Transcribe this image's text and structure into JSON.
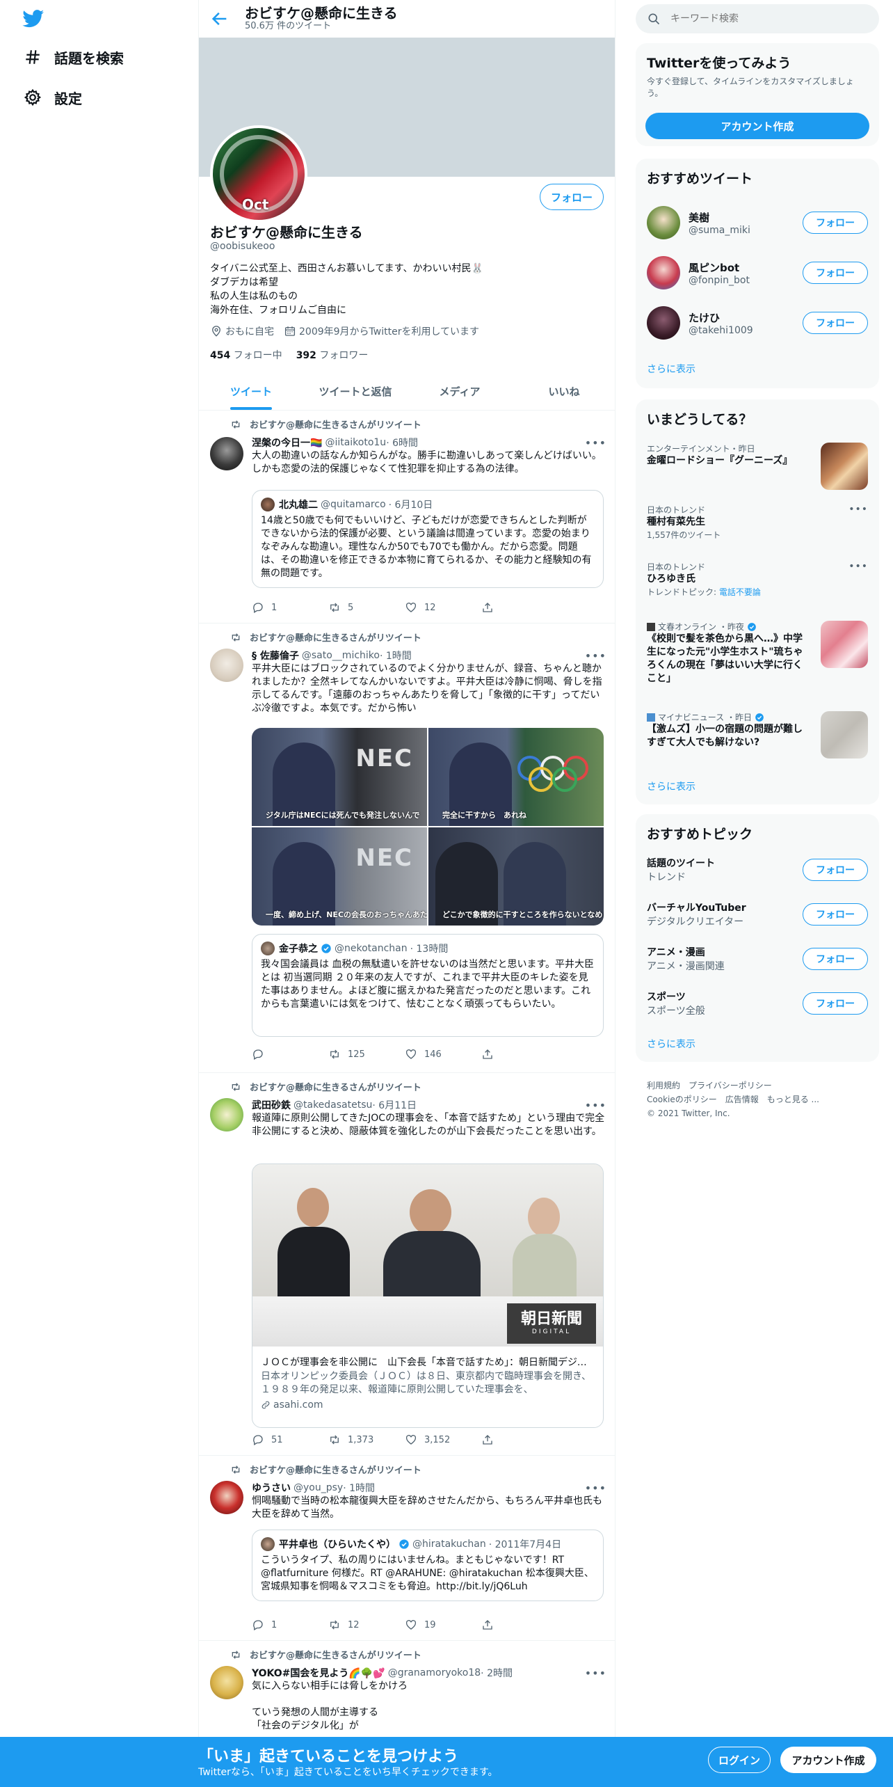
{
  "nav": {
    "explore": "話題を検索",
    "settings": "設定"
  },
  "header": {
    "title": "おビすケ@懸命に生きる",
    "tweet_count": "50.6万 件のツイート"
  },
  "profile": {
    "name": "おビすケ@懸命に生きる",
    "handle": "@oobisukeoo",
    "avatar_text": "Oct",
    "bio": [
      "タイバニ公式至上、西田さんお慕いしてます、かわいい村民🐰",
      "ダブデカは希望",
      "私の人生は私のもの",
      "海外在住、フォロリムご自由に"
    ],
    "location": "おもに自宅",
    "joined": "2009年9月からTwitterを利用しています",
    "following_count": "454",
    "following_label": "フォロー中",
    "followers_count": "392",
    "followers_label": "フォロワー",
    "follow_button": "フォロー"
  },
  "tabs": [
    "ツイート",
    "ツイートと返信",
    "メディア",
    "いいね"
  ],
  "tweets": [
    {
      "retweet_label": "おビすケ@懸命に生きるさんがリツイート",
      "name": "涅槃の今日一🏳️‍🌈",
      "handle": "@iitaikoto1u",
      "time": "· 6時間",
      "text": "大人の勘違いの話なんか知らんがな。勝手に勘違いしあって楽しんどけばいい。しかも恋愛の法的保護じゃなくて性犯罪を抑止する為の法律。",
      "quote": {
        "name": "北丸雄二",
        "handle": "@quitamarco",
        "time": "· 6月10日",
        "text": "14歳と50歳でも何でもいいけど、子どもだけが恋愛できちんとした判断ができないから法的保護が必要、という議論は間違っています。恋愛の始まりなぞみんな勘違い。理性なんか50でも70でも働かん。だから恋愛。問題は、その勘違いを修正できるか本物に育てられるか、その能力と経験知の有無の問題です。"
      },
      "replies": "1",
      "retweets": "5",
      "likes": "12"
    },
    {
      "retweet_label": "おビすケ@懸命に生きるさんがリツイート",
      "name": "§ 佐藤倫子",
      "handle": "@sato__michiko",
      "time": "· 1時間",
      "text": "平井大臣にはブロックされているのでよく分かりませんが、録音、ちゃんと聴かれましたか？全然キレてなんかいないですよ。平井大臣は冷静に恫喝、脅しを指示してるんです。「遠藤のおっちゃんあたりを脅して」「象徴的に干す」ってだいぶ冷徹ですよ。本気です。だから怖い",
      "images": [
        {
          "caption": "ジタル庁はNECには死んでも発注しないんで",
          "logo": "NEC"
        },
        {
          "caption": "完全に干すから　あれね",
          "logo": ""
        },
        {
          "caption": "一度、締め上げ、NECの会長のおっちゃんあたりを脅しておいた方がいいよ",
          "logo": "NEC"
        },
        {
          "caption": "どこかで象徴的に干すところを作らないとなめられちゃうからね",
          "logo": ""
        }
      ],
      "quote": {
        "name": "金子恭之",
        "handle": "@nekotanchan",
        "time": "· 13時間",
        "text": "我々国会議員は 血税の無駄遣いを許せないのは当然だと思います。平井大臣とは 初当選同期 ２０年来の友人ですが、これまで平井大臣のキレた姿を見た事はありません。よほど腹に据えかねた発言だったのだと思います。これからも言葉遣いには気をつけて、怯むことなく頑張ってもらいたい。"
      },
      "replies": "",
      "retweets": "125",
      "likes": "146"
    },
    {
      "retweet_label": "おビすケ@懸命に生きるさんがリツイート",
      "name": "武田砂鉄",
      "handle": "@takedasatetsu",
      "time": "· 6月11日",
      "text": "報道陣に原則公開してきたJOCの理事会を、「本音で話すため」という理由で完全非公開にすると決め、隠蔽体質を強化したのが山下会長だったことを思い出す。",
      "link": {
        "title": "ＪＯＣが理事会を非公開に　山下会長「本音で話すため」：朝日新聞デジタル",
        "desc": "日本オリンピック委員会（ＪＯＣ）は８日、東京都内で臨時理事会を開き、１９８９年の発足以来、報道陣に原則公開していた理事会を、",
        "domain": "asahi.com",
        "watermark": "朝日新聞",
        "watermark_sub": "DIGITAL"
      },
      "replies": "51",
      "retweets": "1,373",
      "likes": "3,152"
    },
    {
      "retweet_label": "おビすケ@懸命に生きるさんがリツイート",
      "name": "ゆうさい",
      "handle": "@you_psy",
      "time": "· 1時間",
      "text": "恫喝騒動で当時の松本龍復興大臣を辞めさせたんだから、もちろん平井卓也氏も大臣を辞めて当然。",
      "quote": {
        "name": "平井卓也（ひらいたくや）",
        "handle": "@hiratakuchan",
        "time": "· 2011年7月4日",
        "text": "こういうタイプ、私の周りにはいませんね。まともじゃないです！RT @flatfurniture 何様だ。RT @ARAHUNE: @hiratakuchan 松本復興大臣、宮城県知事を恫喝＆マスコミをも脅迫。http://bit.ly/jQ6Luh"
      },
      "replies": "1",
      "retweets": "12",
      "likes": "19"
    },
    {
      "retweet_label": "おビすケ@懸命に生きるさんがリツイート",
      "name": "YOKO#国会を見よう🌈🌳💕",
      "handle": "@granamoryoko18",
      "time": "· 2時間",
      "text": "気に入らない相手には脅しをかけろ\n\nていう発想の人間が主導する\n「社会のデジタル化」が"
    }
  ],
  "right": {
    "search_placeholder": "キーワード検索",
    "signup_card": {
      "title": "Twitterを使ってみよう",
      "desc": "今すぐ登録して、タイムラインをカスタマイズしましょう。",
      "button": "アカウント作成"
    },
    "recommend": {
      "title": "おすすめツイート",
      "users": [
        {
          "name": "美樹",
          "handle": "@suma_miki"
        },
        {
          "name": "風ピンbot",
          "handle": "@fonpin_bot"
        },
        {
          "name": "たけひ",
          "handle": "@takehi1009"
        }
      ],
      "follow": "フォロー",
      "more": "さらに表示"
    },
    "trends": {
      "title": "いまどうしてる？",
      "items": [
        {
          "context": "エンターテインメント・昨日",
          "name": "金曜ロードショー『グーニーズ』",
          "extra": ""
        },
        {
          "context": "日本のトレンド",
          "name": "種村有菜先生",
          "extra": "1,557件のツイート"
        },
        {
          "context": "日本のトレンド",
          "name": "ひろゆき氏",
          "extra": "トレンドトピック: ",
          "extra_link": "電話不要論"
        },
        {
          "context": "文春オンライン ・昨夜",
          "name": "《校則で髪を茶色から黒へ…》中学生になった元\"小学生ホスト\"琉ちゃろくんの現在「夢はいい大学に行くこと」",
          "extra": ""
        },
        {
          "context": "マイナビニュース ・昨日",
          "name": "【激ムズ】小一の宿題の問題が難しすぎて大人でも解けない?",
          "extra": ""
        }
      ],
      "more": "さらに表示"
    },
    "topics": {
      "title": "おすすめトピック",
      "items": [
        {
          "name": "話題のツイート",
          "sub": "トレンド"
        },
        {
          "name": "バーチャルYouTuber",
          "sub": "デジタルクリエイター"
        },
        {
          "name": "アニメ・漫画",
          "sub": "アニメ・漫画関連"
        },
        {
          "name": "スポーツ",
          "sub": "スポーツ全般"
        }
      ],
      "follow": "フォロー",
      "more": "さらに表示"
    },
    "footer": {
      "line1": "利用規約　プライバシーポリシー",
      "line2": "Cookieのポリシー　広告情報　もっと見る ...",
      "line3": "© 2021 Twitter, Inc."
    }
  },
  "bottombar": {
    "headline": "「いま」起きていることを見つけよう",
    "sub": "Twitterなら、「いま」起きていることをいち早くチェックできます。",
    "login": "ログイン",
    "signup": "アカウント作成"
  },
  "colors": {
    "accent": "#1d9bf0",
    "text": "#0f1419",
    "muted": "#536471",
    "banner": "#cfd9de"
  }
}
